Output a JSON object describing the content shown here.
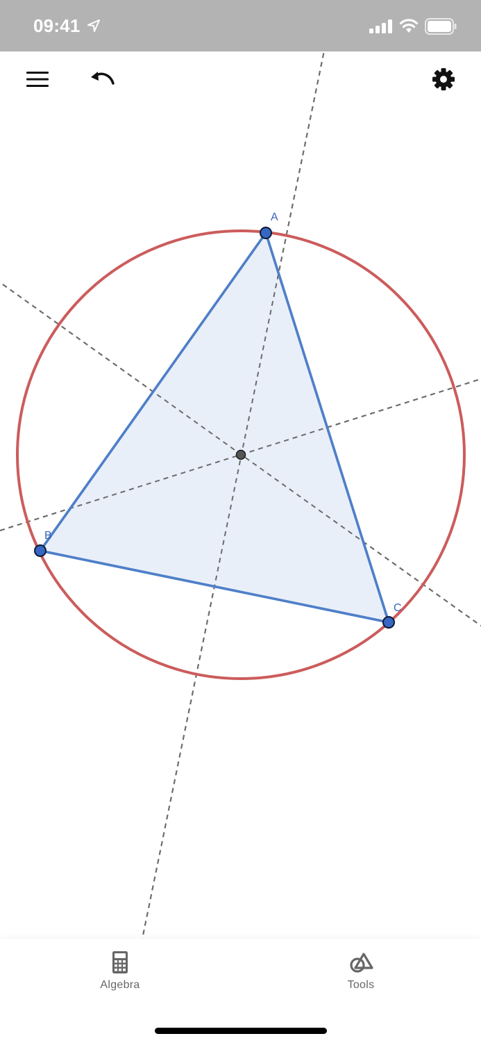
{
  "status_bar": {
    "time": "09:41",
    "background": "#b3b3b3"
  },
  "toolbar": {
    "menu_icon": "hamburger-menu-icon",
    "undo_icon": "undo-icon",
    "settings_icon": "gear-icon"
  },
  "construction": {
    "points": {
      "A": "A",
      "B": "B",
      "C": "C"
    },
    "colors": {
      "triangle_stroke": "#4f7fc8",
      "triangle_fill": "#e8eef9",
      "circle_stroke": "#cc5c5c",
      "bisector_stroke": "#6b6b6b",
      "point_fill": "#3766c3",
      "center_fill": "#555555"
    }
  },
  "bottom_nav": {
    "algebra_label": "Algebra",
    "tools_label": "Tools",
    "algebra_icon": "calculator-icon",
    "tools_icon": "geometry-tools-icon"
  }
}
